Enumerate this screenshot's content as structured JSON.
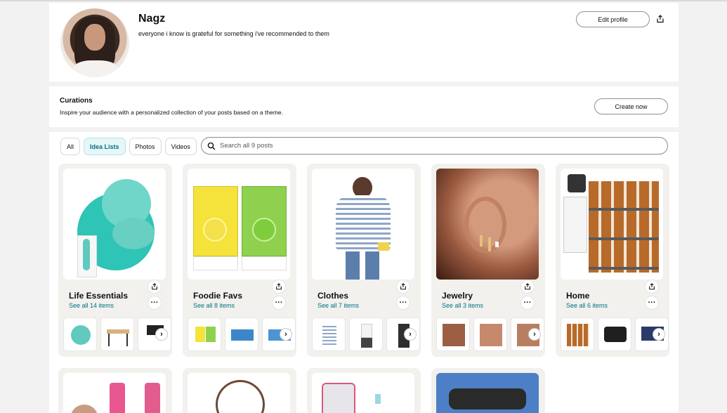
{
  "profile": {
    "name": "Nagz",
    "bio": "everyone i know is grateful for something i've recommended to them",
    "edit_label": "Edit profile"
  },
  "curations": {
    "title": "Curations",
    "description": "Inspire your audience with a personalized collection of your posts based on a theme.",
    "create_label": "Create now"
  },
  "filters": [
    "All",
    "Idea Lists",
    "Photos",
    "Videos"
  ],
  "search": {
    "placeholder": "Search all 9 posts"
  },
  "lists": [
    {
      "title": "Life Essentials",
      "count": "See all 14 items"
    },
    {
      "title": "Foodie Favs",
      "count": "See all 8 items"
    },
    {
      "title": "Clothes",
      "count": "See all 7 items"
    },
    {
      "title": "Jewelry",
      "count": "See all 3 items"
    },
    {
      "title": "Home",
      "count": "See all 6 items"
    }
  ],
  "colors": {
    "accent_link": "#007185",
    "active_chip_bg": "#e6f7f8"
  }
}
